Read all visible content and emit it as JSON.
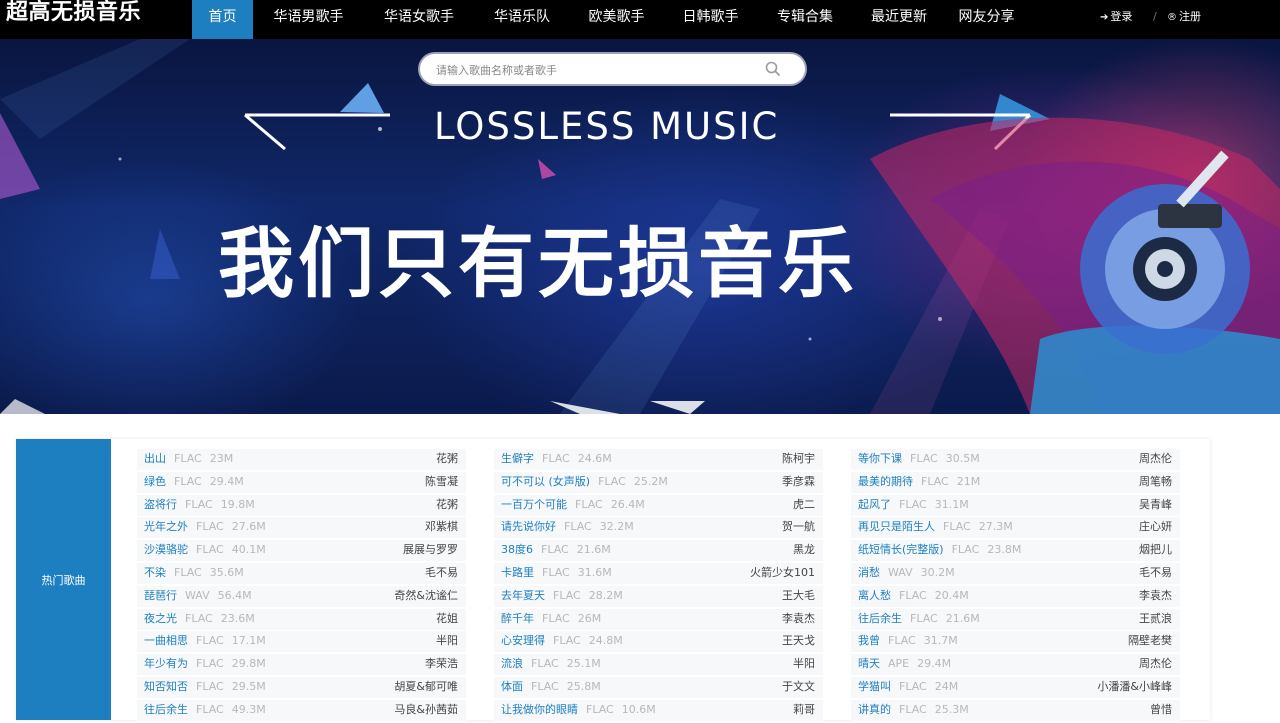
{
  "site": {
    "brand": "超高无损音乐"
  },
  "nav": {
    "items": [
      {
        "label": "首页",
        "active": true
      },
      {
        "label": "华语男歌手"
      },
      {
        "label": "华语女歌手"
      },
      {
        "label": "华语乐队"
      },
      {
        "label": "欧美歌手"
      },
      {
        "label": "日韩歌手"
      },
      {
        "label": "专辑合集"
      },
      {
        "label": "最近更新"
      },
      {
        "label": "网友分享"
      }
    ],
    "login": "登录",
    "register": "注册",
    "separator": "/"
  },
  "search": {
    "placeholder": "请输入歌曲名称或者歌手"
  },
  "banner": {
    "heading": "LOSSLESS MUSIC",
    "slogan": "我们只有无损音乐"
  },
  "hot": {
    "label": "热门歌曲",
    "columns": [
      [
        {
          "title": "出山",
          "format": "FLAC",
          "size": "23M",
          "artist": "花粥"
        },
        {
          "title": "绿色",
          "format": "FLAC",
          "size": "29.4M",
          "artist": "陈雪凝"
        },
        {
          "title": "盗将行",
          "format": "FLAC",
          "size": "19.8M",
          "artist": "花粥"
        },
        {
          "title": "光年之外",
          "format": "FLAC",
          "size": "27.6M",
          "artist": "邓紫棋"
        },
        {
          "title": "沙漠骆驼",
          "format": "FLAC",
          "size": "40.1M",
          "artist": "展展与罗罗"
        },
        {
          "title": "不染",
          "format": "FLAC",
          "size": "35.6M",
          "artist": "毛不易"
        },
        {
          "title": "琵琶行",
          "format": "WAV",
          "size": "56.4M",
          "artist": "奇然&沈谧仁"
        },
        {
          "title": "夜之光",
          "format": "FLAC",
          "size": "23.6M",
          "artist": "花姐"
        },
        {
          "title": "一曲相思",
          "format": "FLAC",
          "size": "17.1M",
          "artist": "半阳"
        },
        {
          "title": "年少有为",
          "format": "FLAC",
          "size": "29.8M",
          "artist": "李荣浩"
        },
        {
          "title": "知否知否",
          "format": "FLAC",
          "size": "29.5M",
          "artist": "胡夏&郁可唯"
        },
        {
          "title": "往后余生",
          "format": "FLAC",
          "size": "49.3M",
          "artist": "马良&孙茜茹"
        }
      ],
      [
        {
          "title": "生僻字",
          "format": "FLAC",
          "size": "24.6M",
          "artist": "陈柯宇"
        },
        {
          "title": "可不可以 (女声版)",
          "format": "FLAC",
          "size": "25.2M",
          "artist": "季彦霖"
        },
        {
          "title": "一百万个可能",
          "format": "FLAC",
          "size": "26.4M",
          "artist": "虎二"
        },
        {
          "title": "请先说你好",
          "format": "FLAC",
          "size": "32.2M",
          "artist": "贺一航"
        },
        {
          "title": "38度6",
          "format": "FLAC",
          "size": "21.6M",
          "artist": "黑龙"
        },
        {
          "title": "卡路里",
          "format": "FLAC",
          "size": "31.6M",
          "artist": "火箭少女101"
        },
        {
          "title": "去年夏天",
          "format": "FLAC",
          "size": "28.2M",
          "artist": "王大毛"
        },
        {
          "title": "醉千年",
          "format": "FLAC",
          "size": "26M",
          "artist": "李袁杰"
        },
        {
          "title": "心安理得",
          "format": "FLAC",
          "size": "24.8M",
          "artist": "王天戈"
        },
        {
          "title": "流浪",
          "format": "FLAC",
          "size": "25.1M",
          "artist": "半阳"
        },
        {
          "title": "体面",
          "format": "FLAC",
          "size": "25.8M",
          "artist": "于文文"
        },
        {
          "title": "让我做你的眼睛",
          "format": "FLAC",
          "size": "10.6M",
          "artist": "莉哥"
        }
      ],
      [
        {
          "title": "等你下课",
          "format": "FLAC",
          "size": "30.5M",
          "artist": "周杰伦"
        },
        {
          "title": "最美的期待",
          "format": "FLAC",
          "size": "21M",
          "artist": "周笔畅"
        },
        {
          "title": "起风了",
          "format": "FLAC",
          "size": "31.1M",
          "artist": "吴青峰"
        },
        {
          "title": "再见只是陌生人",
          "format": "FLAC",
          "size": "27.3M",
          "artist": "庄心妍"
        },
        {
          "title": "纸短情长(完整版)",
          "format": "FLAC",
          "size": "23.8M",
          "artist": "烟把儿"
        },
        {
          "title": "消愁",
          "format": "WAV",
          "size": "30.2M",
          "artist": "毛不易"
        },
        {
          "title": "离人愁",
          "format": "FLAC",
          "size": "20.4M",
          "artist": "李袁杰"
        },
        {
          "title": "往后余生",
          "format": "FLAC",
          "size": "21.6M",
          "artist": "王贰浪"
        },
        {
          "title": "我曾",
          "format": "FLAC",
          "size": "31.7M",
          "artist": "隔壁老樊"
        },
        {
          "title": "晴天",
          "format": "APE",
          "size": "29.4M",
          "artist": "周杰伦"
        },
        {
          "title": "学猫叫",
          "format": "FLAC",
          "size": "24M",
          "artist": "小潘潘&小峰峰"
        },
        {
          "title": "讲真的",
          "format": "FLAC",
          "size": "25.3M",
          "artist": "曾惜"
        }
      ]
    ]
  },
  "colors": {
    "accent": "#1e7fc0",
    "topbar": "#000000",
    "meta_text": "#b8b8b8"
  }
}
